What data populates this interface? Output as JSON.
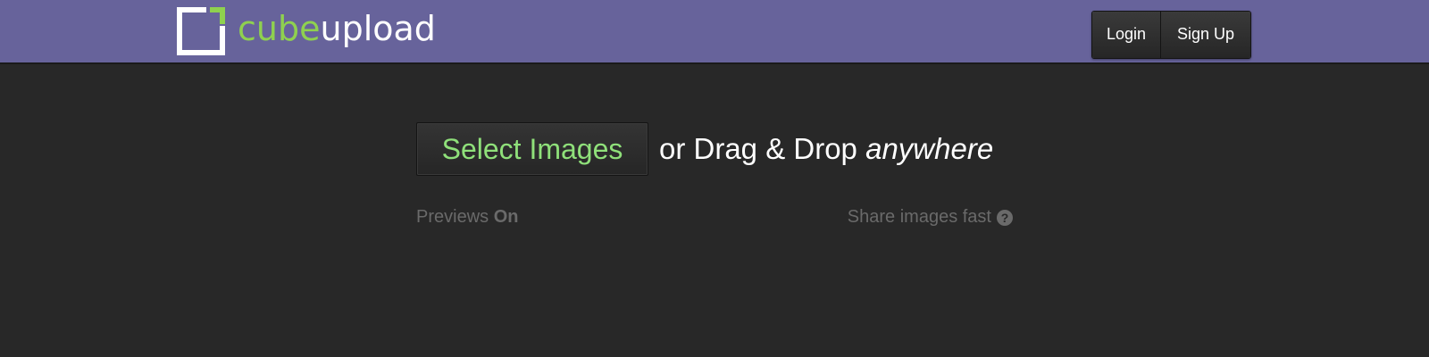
{
  "header": {
    "logo": {
      "part1": "cube",
      "part2": "upload"
    },
    "login_label": "Login",
    "signup_label": "Sign Up"
  },
  "upload": {
    "select_label": "Select Images",
    "drag_text": "or Drag & Drop",
    "drag_emphasis": "anywhere"
  },
  "options": {
    "previews_label": "Previews",
    "previews_state": "On",
    "share_text": "Share images fast",
    "help_icon": "?"
  },
  "colors": {
    "header_bg": "#67639b",
    "page_bg": "#282828",
    "accent_green": "#8fd14f"
  }
}
